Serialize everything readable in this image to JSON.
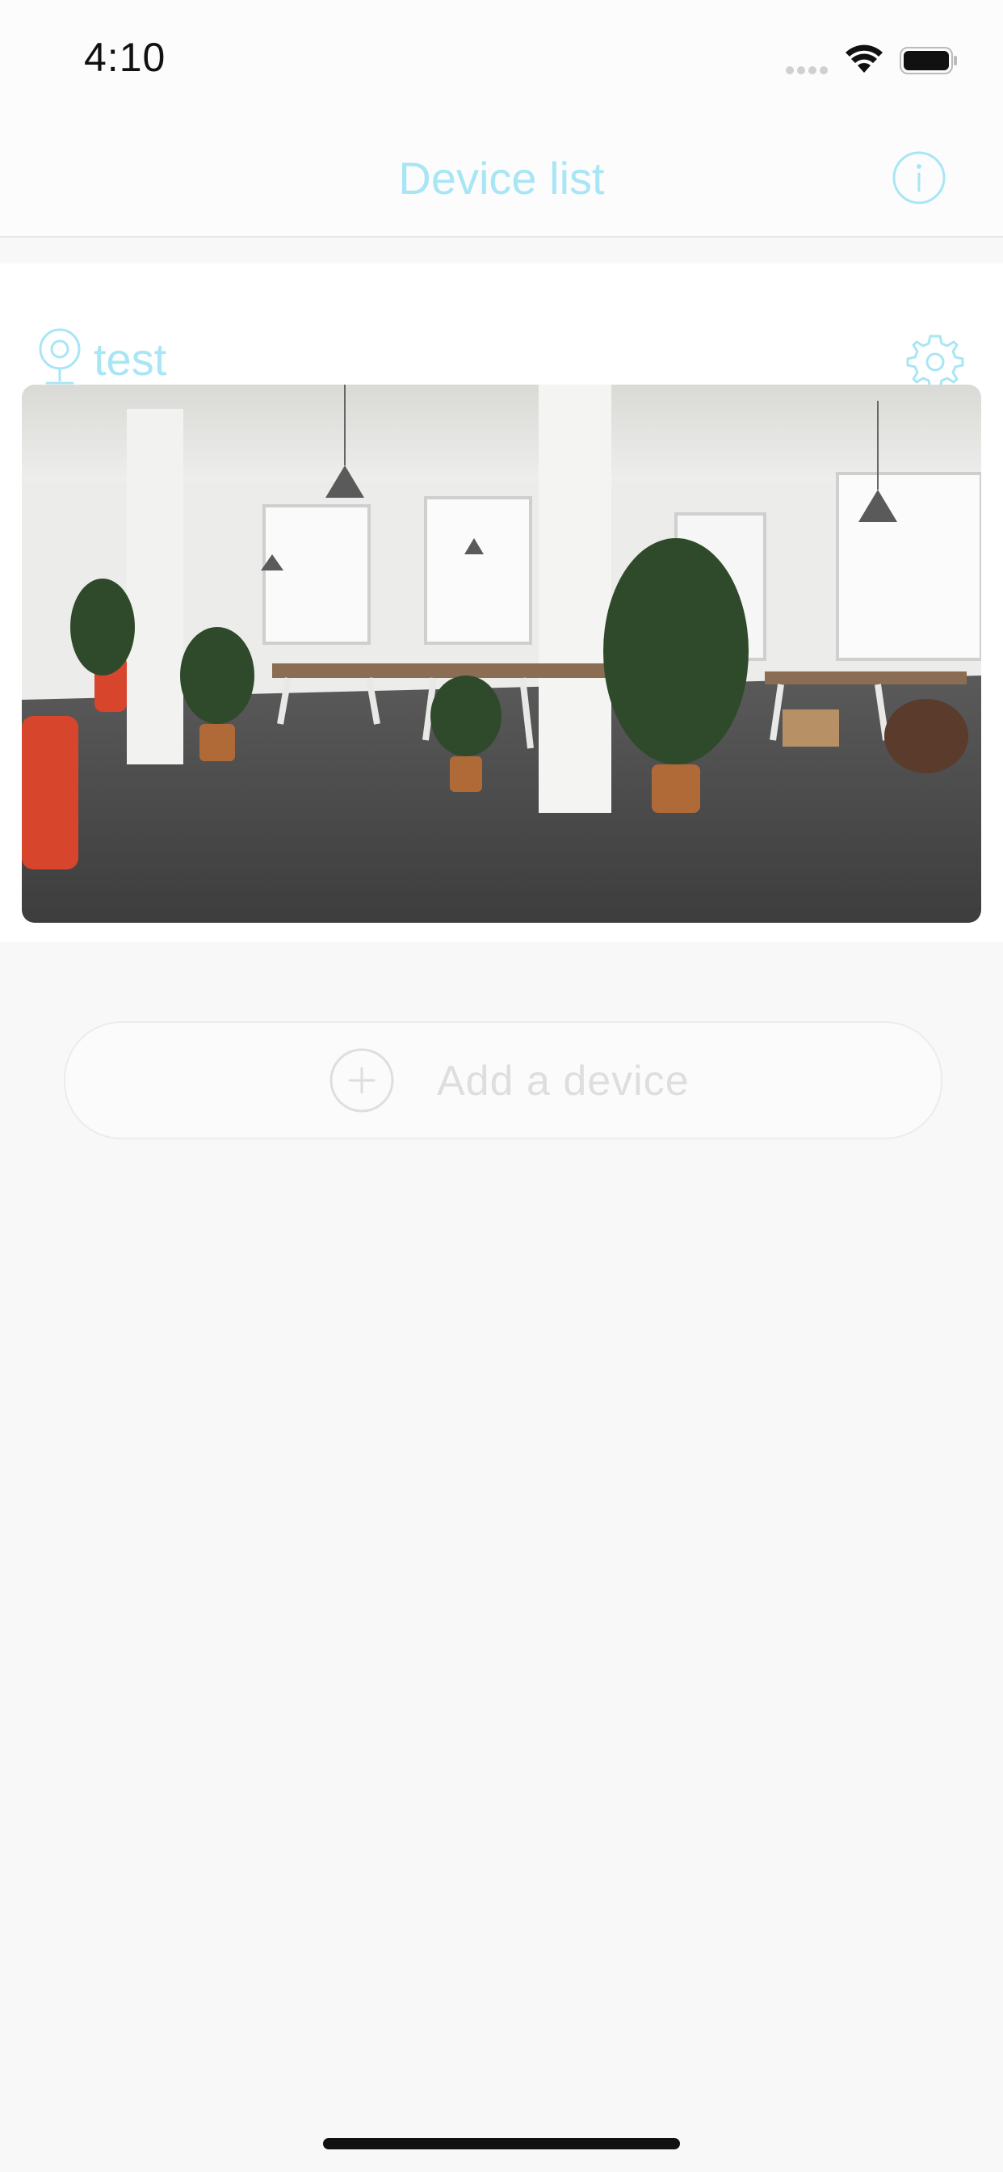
{
  "status_bar": {
    "time": "4:10",
    "signal_icon": "cellular-signal-icon",
    "wifi_icon": "wifi-icon",
    "battery_icon": "battery-icon"
  },
  "nav": {
    "title": "Device list",
    "info_icon": "info-icon"
  },
  "devices": [
    {
      "name": "test",
      "icon": "camera-icon",
      "settings_icon": "gear-icon"
    }
  ],
  "add_device": {
    "label": "Add a device",
    "icon": "plus-circle-icon"
  },
  "colors": {
    "accent": "#a8e6f5",
    "background": "#f8f8f8",
    "muted": "#dedede"
  }
}
